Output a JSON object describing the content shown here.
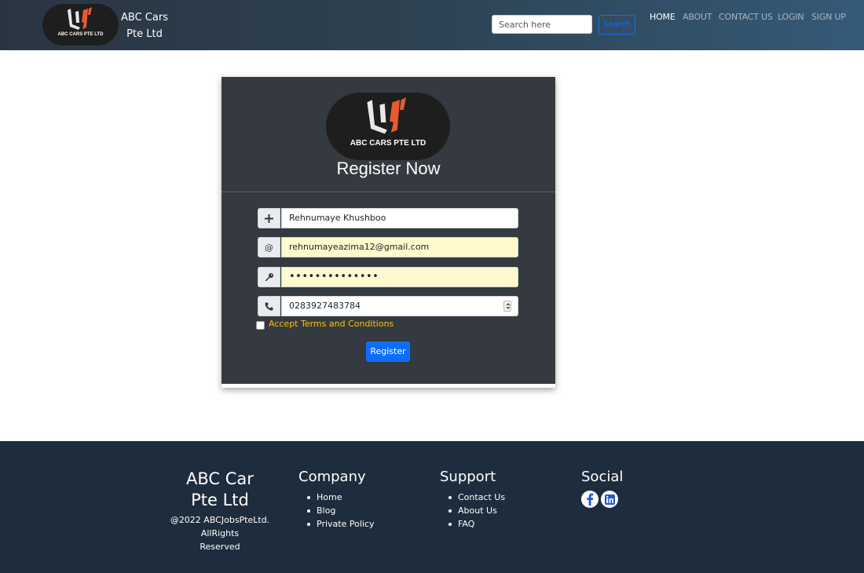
{
  "nav": {
    "logo_caption": "ABC CARS PTE LTD",
    "brand_line1": "ABC Cars",
    "brand_line2": "Pte Ltd",
    "search_placeholder": "Search here",
    "search_button": "Search",
    "links": [
      {
        "label": "HOME",
        "active": true
      },
      {
        "label": "ABOUT",
        "active": false
      },
      {
        "label": "CONTACT US",
        "active": false
      },
      {
        "label": "LOGIN",
        "active": false
      },
      {
        "label": "SIGN UP",
        "active": false
      }
    ]
  },
  "card": {
    "logo_caption": "ABC CARS PTE LTD",
    "title": "Register Now",
    "fields": [
      {
        "icon": "plus-icon",
        "value": "Rehnumaye Khushboo"
      },
      {
        "icon": "at-icon",
        "value": "rehnumayeazima12@gmail.com"
      },
      {
        "icon": "key-icon",
        "value": "••••••••••••••"
      },
      {
        "icon": "phone-icon",
        "value": "0283927483784"
      }
    ],
    "terms_label": "Accept Terms and Conditions",
    "register_button": "Register"
  },
  "footer": {
    "brand_line1": "ABC Car",
    "brand_line2": "Pte Ltd",
    "copy_line1": "@2022 ABCJobsPteLtd. AllRights",
    "copy_line2": "Reserved",
    "company": {
      "title": "Company",
      "items": [
        "Home",
        "Blog",
        "Private Policy"
      ]
    },
    "support": {
      "title": "Support",
      "items": [
        "Contact Us",
        "About Us",
        "FAQ"
      ]
    },
    "social": {
      "title": "Social",
      "icons": [
        "facebook-icon",
        "linkedin-icon"
      ]
    }
  },
  "colors": {
    "accent_blue": "#0d6efd",
    "terms_yellow": "#ffc107",
    "card_dark": "#343a40",
    "footer_bg": "#1e2d3d",
    "autofill": "#fffacd"
  }
}
